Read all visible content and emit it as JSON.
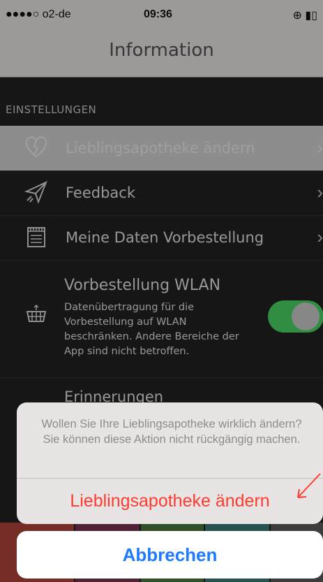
{
  "status_bar": {
    "carrier": "●●●●○ o2-de",
    "time": "09:36",
    "right_icons": "⊕ ▮▯"
  },
  "header": {
    "title": "Information"
  },
  "settings": {
    "section_title": "EINSTELLUNGEN",
    "rows": [
      {
        "label": "Lieblingsapotheke ändern",
        "icon": "broken-heart-icon"
      },
      {
        "label": "Feedback",
        "icon": "paper-plane-icon"
      },
      {
        "label": "Meine Daten Vorbestellung",
        "icon": "notepad-icon"
      }
    ],
    "wlan": {
      "title": "Vorbestellung WLAN",
      "description": "Datenübertragung für die Vorbestellung auf WLAN beschränken. Andere Bereiche der App sind nicht betroffen.",
      "toggle_on": true,
      "icon": "shopping-basket-icon"
    },
    "reminders_label": "Erinnerungen"
  },
  "tab_colors": [
    "#b5453e",
    "#7a3552",
    "#4c7a3e",
    "#3d7f7a",
    "#5d5d5d"
  ],
  "action_sheet": {
    "message": "Wollen Sie Ihre Lieblingsapotheke wirklich ändern? Sie können diese Aktion nicht rückgängig machen.",
    "destructive_label": "Lieblingsapotheke ändern",
    "cancel_label": "Abbrechen"
  },
  "colors": {
    "destructive": "#ff3b30",
    "cancel": "#1e7bff",
    "toggle_on": "#4cd964"
  }
}
